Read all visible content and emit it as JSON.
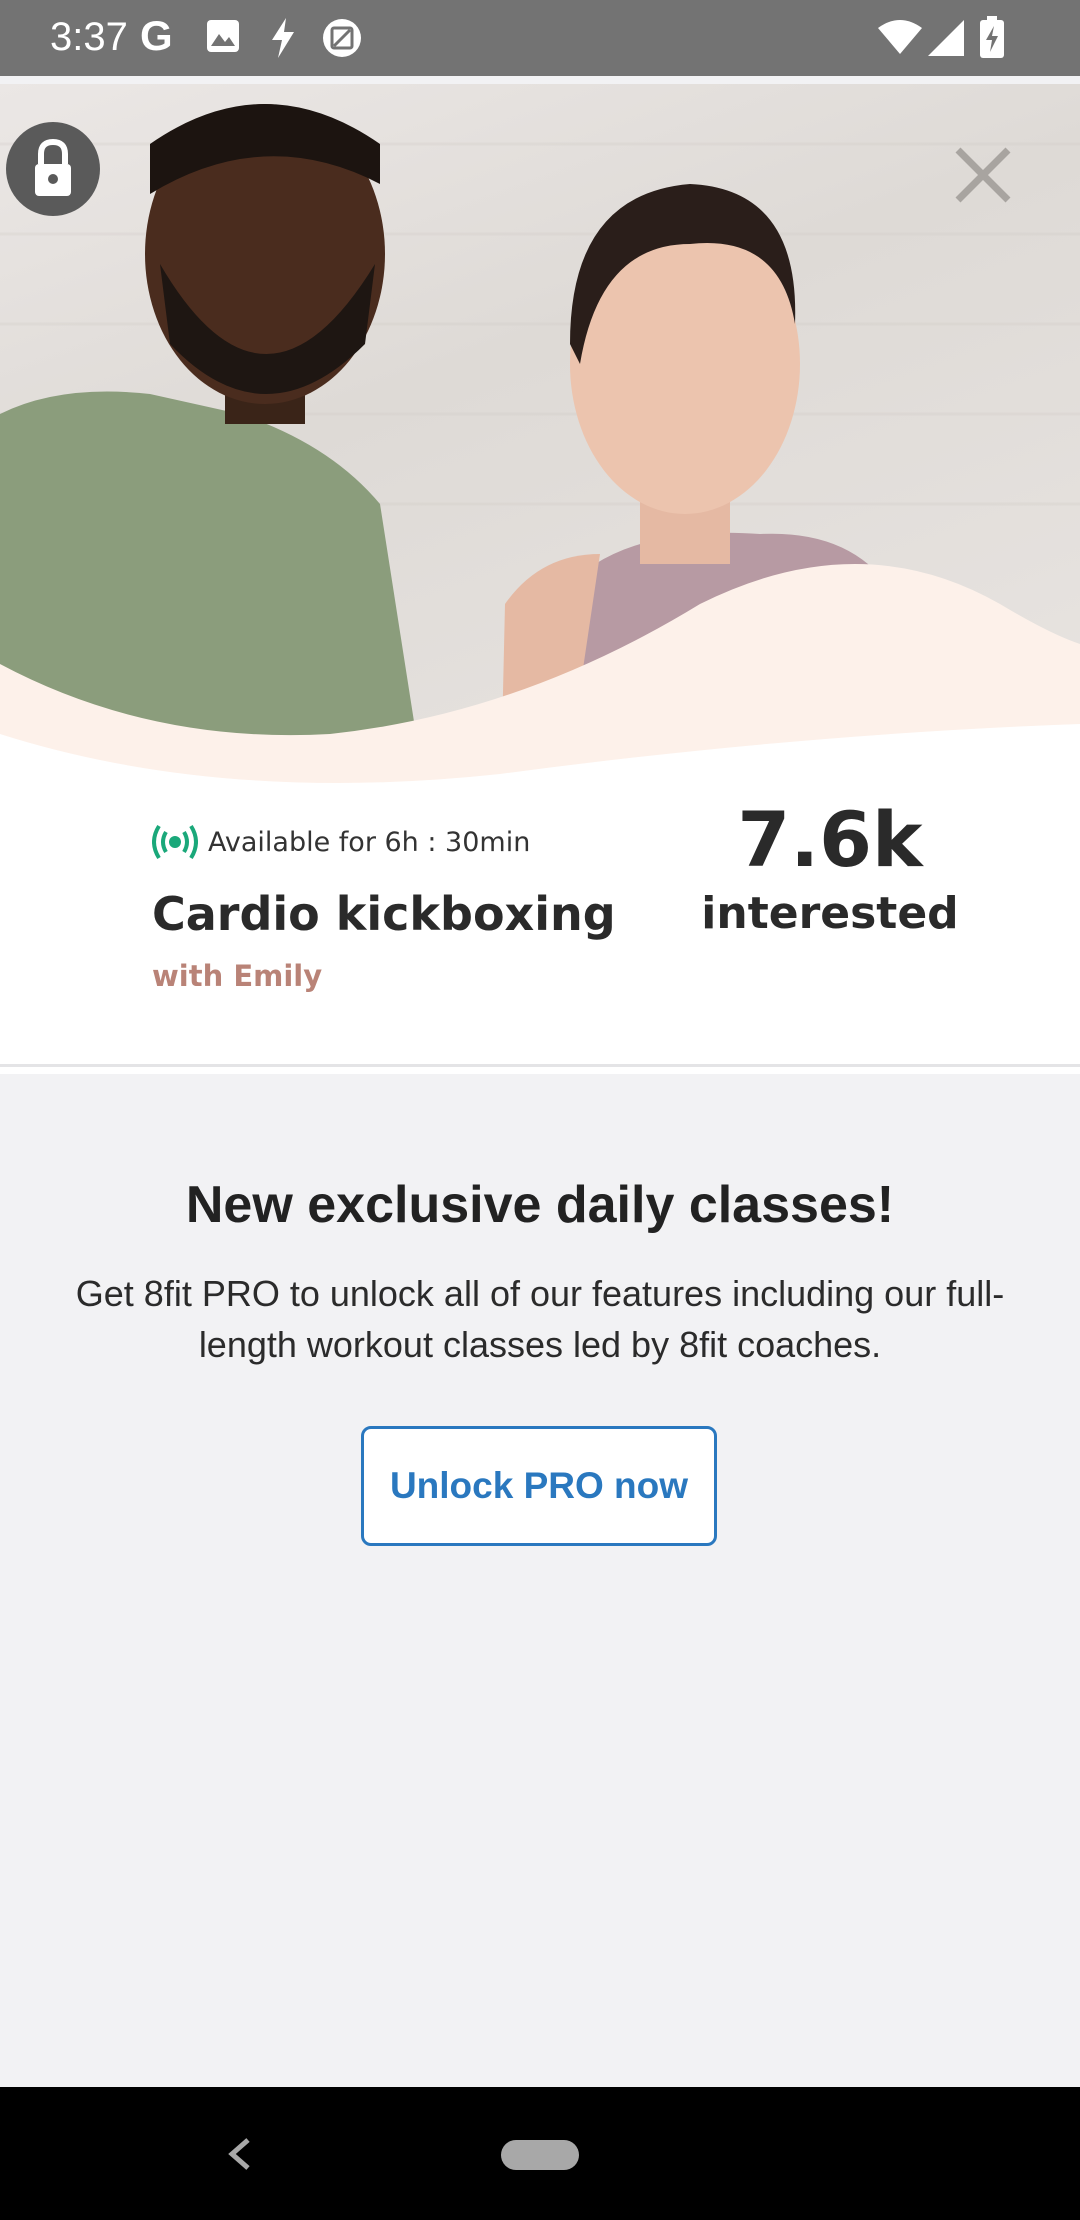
{
  "status_bar": {
    "time": "3:37",
    "left_icons": [
      "google-icon",
      "image-icon",
      "flash-icon",
      "screenshot-icon"
    ],
    "right_icons": [
      "wifi-icon",
      "signal-icon",
      "battery-charging-icon"
    ]
  },
  "hero": {
    "icons": [
      "lock-icon",
      "close-icon"
    ]
  },
  "live_class": {
    "availability": "Available for 6h : 30min",
    "title": "Cardio kickboxing",
    "coach": "with Emily",
    "interested_count": "7.6k",
    "interested_label": "interested",
    "live_color": "#1aa87a",
    "coach_color": "#b98377"
  },
  "promo": {
    "title": "New exclusive daily classes!",
    "description": "Get 8fit PRO to unlock all of our features including our full-length workout classes led by 8fit coaches.",
    "cta_label": "Unlock PRO now",
    "cta_color": "#2a78bf"
  },
  "nav_bar": {
    "icons": [
      "back-icon",
      "home-pill-icon"
    ]
  }
}
